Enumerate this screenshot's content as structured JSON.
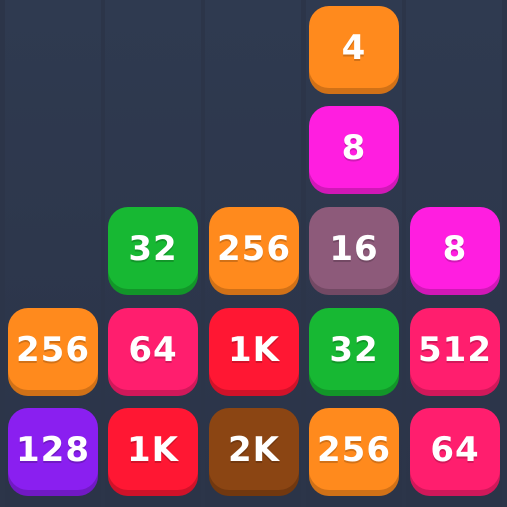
{
  "board": {
    "tiles": [
      {
        "value": "4",
        "color": "#ff8a1d"
      },
      {
        "value": "8",
        "color": "#ff1ee0"
      },
      {
        "value": "32",
        "color": "#17b833"
      },
      {
        "value": "256",
        "color": "#ff8a1d"
      },
      {
        "value": "16",
        "color": "#8d5a7a"
      },
      {
        "value": "8",
        "color": "#ff1ee0"
      },
      {
        "value": "256",
        "color": "#ff8a1d"
      },
      {
        "value": "64",
        "color": "#ff1e6e"
      },
      {
        "value": "1K",
        "color": "#ff1733"
      },
      {
        "value": "32",
        "color": "#17b833"
      },
      {
        "value": "512",
        "color": "#ff1e6e"
      },
      {
        "value": "128",
        "color": "#8a1ff0"
      },
      {
        "value": "1K",
        "color": "#ff1733"
      },
      {
        "value": "2K",
        "color": "#8b4513"
      },
      {
        "value": "256",
        "color": "#ff8a1d"
      },
      {
        "value": "64",
        "color": "#ff1e6e"
      }
    ]
  }
}
